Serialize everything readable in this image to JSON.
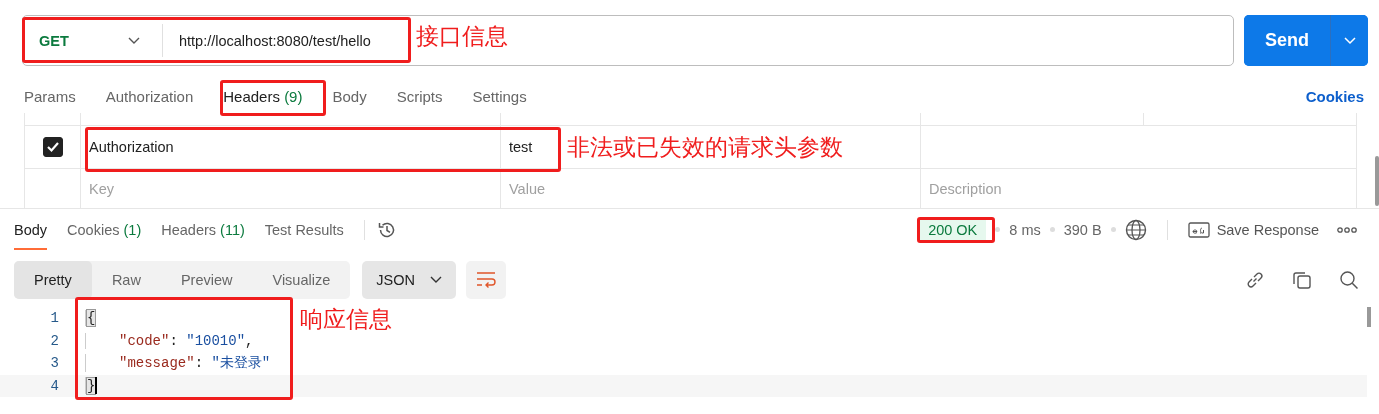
{
  "request": {
    "method": "GET",
    "url": "http://localhost:8080/test/hello",
    "send_label": "Send"
  },
  "request_tabs": [
    {
      "label": "Params",
      "selected": false
    },
    {
      "label": "Authorization",
      "selected": false
    },
    {
      "label": "Headers",
      "count": "(9)",
      "selected": true
    },
    {
      "label": "Body",
      "selected": false
    },
    {
      "label": "Scripts",
      "selected": false
    },
    {
      "label": "Settings",
      "selected": false
    }
  ],
  "cookies_link": "Cookies",
  "headers_table": {
    "rows": [
      {
        "checked": true,
        "key": "Authorization",
        "value": "test"
      }
    ],
    "empty_row": {
      "key": {
        "placeholder": "Key"
      },
      "value": {
        "placeholder": "Value"
      },
      "description": {
        "placeholder": "Description"
      }
    }
  },
  "response_tabs": [
    {
      "label": "Body",
      "selected": true
    },
    {
      "label": "Cookies",
      "count": "(1)",
      "selected": false
    },
    {
      "label": "Headers",
      "count": "(11)",
      "selected": false
    },
    {
      "label": "Test Results",
      "selected": false
    }
  ],
  "response_status": {
    "status": "200 OK",
    "time": "8 ms",
    "size": "390 B",
    "save_label": "Save Response"
  },
  "view_modes": [
    {
      "label": "Pretty",
      "selected": true
    },
    {
      "label": "Raw",
      "selected": false
    },
    {
      "label": "Preview",
      "selected": false
    },
    {
      "label": "Visualize",
      "selected": false
    }
  ],
  "format": "JSON",
  "code_lines": [
    {
      "number": "1",
      "current": false,
      "indented": false,
      "tokens": [
        {
          "kind": "brace",
          "text": "{"
        }
      ]
    },
    {
      "number": "2",
      "current": false,
      "indented": true,
      "tokens": [
        {
          "kind": "key",
          "text": "\"code\""
        },
        {
          "kind": "punct",
          "text": ": "
        },
        {
          "kind": "string",
          "text": "\"10010\""
        },
        {
          "kind": "punct",
          "text": ","
        }
      ]
    },
    {
      "number": "3",
      "current": false,
      "indented": true,
      "tokens": [
        {
          "kind": "key",
          "text": "\"message\""
        },
        {
          "kind": "punct",
          "text": ": "
        },
        {
          "kind": "string",
          "text": "\"未登录\""
        }
      ]
    },
    {
      "number": "4",
      "current": true,
      "indented": false,
      "tokens": [
        {
          "kind": "brace",
          "text": "}"
        }
      ]
    }
  ],
  "annotations": [
    {
      "kind": "request",
      "text": "接口信息"
    },
    {
      "kind": "headers-tab"
    },
    {
      "kind": "header-row",
      "text": "非法或已失效的请求头参数"
    },
    {
      "kind": "status"
    },
    {
      "kind": "response",
      "text": "响应信息"
    }
  ]
}
